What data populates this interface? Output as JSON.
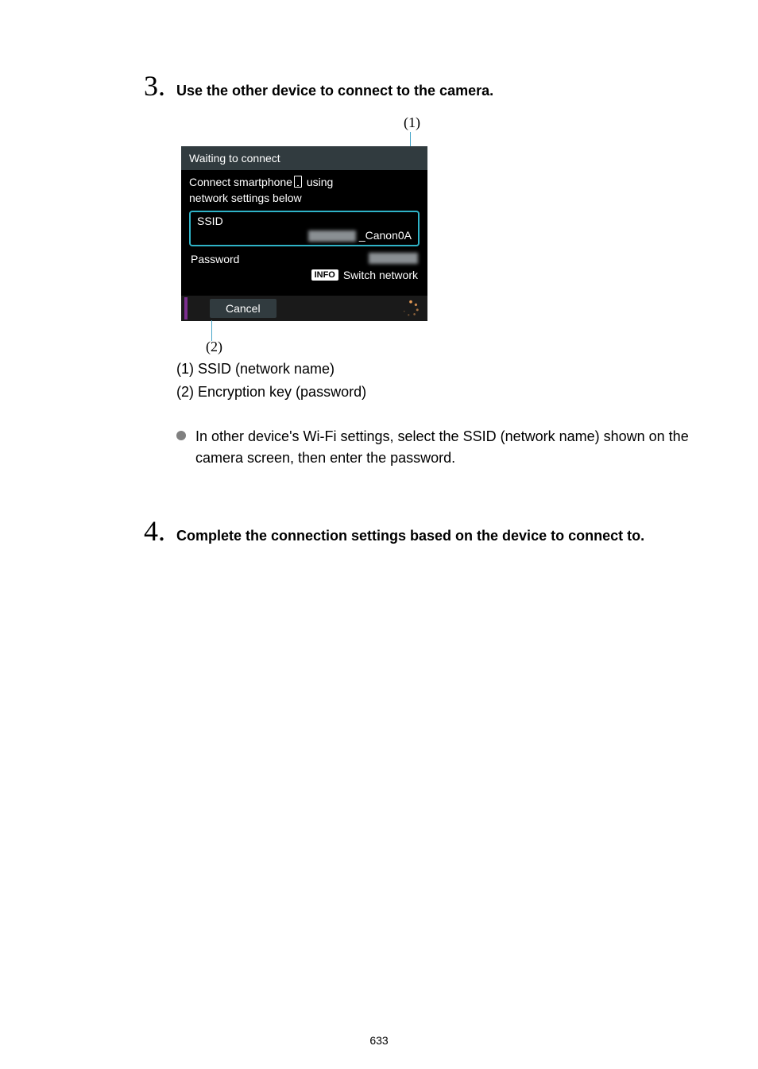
{
  "step3": {
    "number": "3.",
    "title": "Use the other device to connect to the camera.",
    "callout1": "(1)",
    "callout2": "(2)",
    "legend1": "(1) SSID (network name)",
    "legend2": "(2) Encryption key (password)",
    "bullet": "In other device's Wi-Fi settings, select the SSID (network name) shown on the camera screen, then enter the password."
  },
  "screen": {
    "title": "Waiting to connect",
    "instr_pre": "Connect smartphone",
    "instr_post": " using",
    "instr2": "network settings below",
    "ssid_label": "SSID",
    "ssid_value": "_Canon0A",
    "password_label": "Password",
    "info_badge": "INFO",
    "switch_network": "Switch network",
    "cancel": "Cancel"
  },
  "step4": {
    "number": "4.",
    "title": "Complete the connection settings based on the device to connect to."
  },
  "page_number": "633"
}
